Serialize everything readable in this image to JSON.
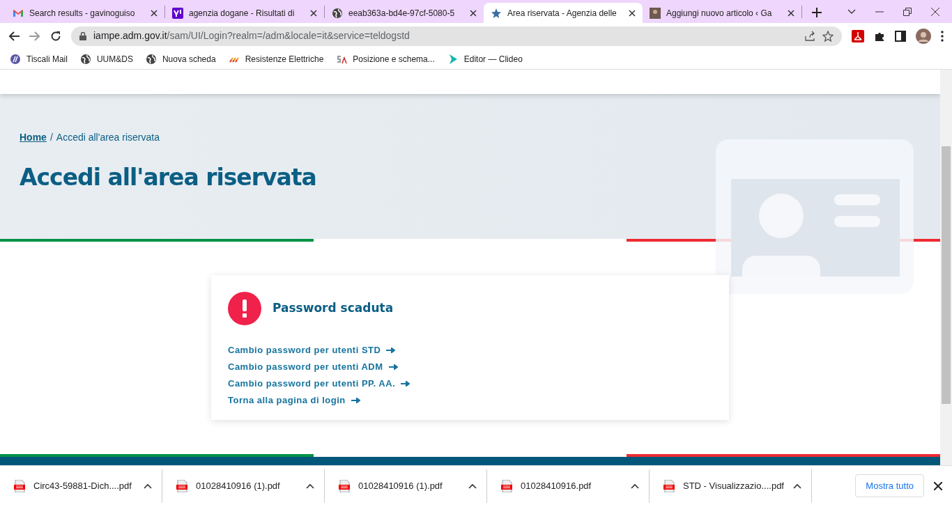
{
  "tabs": [
    {
      "title": "Search results - gavinoguiso",
      "kind": "mail",
      "selected": false
    },
    {
      "title": "agenzia dogane - Risultati di",
      "kind": "yahoo",
      "selected": false
    },
    {
      "title": "eeab363a-bd4e-97cf-5080-5",
      "kind": "globe",
      "selected": false
    },
    {
      "title": "Area riservata - Agenzia delle",
      "kind": "star",
      "selected": true
    },
    {
      "title": "Aggiungi nuovo articolo ‹ Ga",
      "kind": "photo",
      "selected": false
    }
  ],
  "address": {
    "host": "iampe.adm.gov.it",
    "path": "/sam/UI/Login?realm=/adm&locale=it&service=teldogstd"
  },
  "bookmarks": [
    {
      "label": "Tiscali Mail",
      "kind": "tiscali"
    },
    {
      "label": "UUM&DS",
      "kind": "globe"
    },
    {
      "label": "Nuova scheda",
      "kind": "globe"
    },
    {
      "label": "Resistenze Elettriche",
      "kind": "stripes"
    },
    {
      "label": "Posizione e schema...",
      "kind": "sa"
    },
    {
      "label": "Editor — Clideo",
      "kind": "play"
    }
  ],
  "breadcrumb": {
    "items": [
      "Home",
      "Accedi all'area riservata"
    ],
    "separator": "/"
  },
  "page_title": "Accedi all'area riservata",
  "card": {
    "title": "Password scaduta",
    "links": [
      "Cambio password per utenti STD",
      "Cambio password per utenti ADM",
      "Cambio password per utenti PP. AA.",
      "Torna alla pagina di login"
    ]
  },
  "downloads": [
    "Circ43-59881-Dich....pdf",
    "01028410916 (1).pdf",
    "01028410916 (1).pdf",
    "01028410916.pdf",
    "STD - Visualizzazio....pdf"
  ],
  "show_all": "Mostra tutto"
}
